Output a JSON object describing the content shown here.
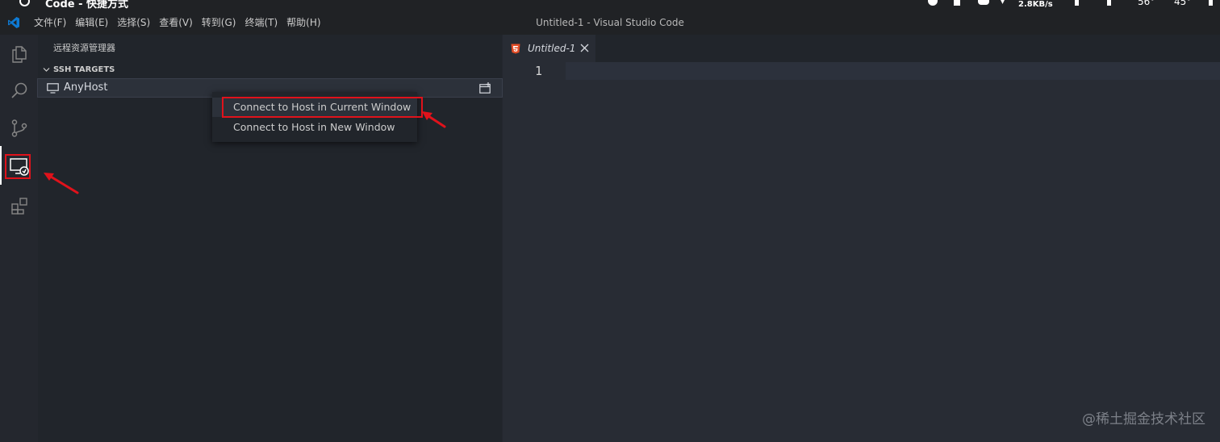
{
  "os": {
    "title": "Code - 快捷方式",
    "network_speed": "2.8KB/s",
    "temp1": "56°",
    "temp2": "45°"
  },
  "menubar": {
    "items": [
      "文件(F)",
      "编辑(E)",
      "选择(S)",
      "查看(V)",
      "转到(G)",
      "终端(T)",
      "帮助(H)"
    ],
    "window_title": "Untitled-1 - Visual Studio Code"
  },
  "activitybar": {
    "icons": [
      "explorer-icon",
      "search-icon",
      "source-control-icon",
      "remote-explorer-icon",
      "extensions-icon"
    ],
    "active": "remote-explorer-icon"
  },
  "sidebar": {
    "title": "远程资源管理器",
    "section": "SSH TARGETS",
    "host": "AnyHost"
  },
  "context_menu": {
    "items": [
      "Connect to Host in Current Window",
      "Connect to Host in New Window"
    ]
  },
  "editor": {
    "tab_title": "Untitled-1",
    "line_number": "1"
  },
  "watermark": "@稀土掘金技术社区",
  "colors": {
    "accent_red": "#e0121b",
    "html_icon": "#e44d26",
    "vscode_blue": "#0e7ad3"
  }
}
